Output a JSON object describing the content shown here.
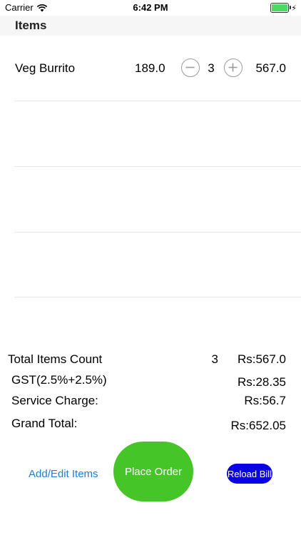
{
  "status_bar": {
    "carrier": "Carrier",
    "time": "6:42 PM",
    "wifi_icon": "wifi-icon",
    "battery_icon": "battery-icon",
    "charging_icon": "bolt-icon"
  },
  "section": {
    "title": "Items"
  },
  "items": [
    {
      "name": "Veg Burrito",
      "price": "189.0",
      "quantity": "3",
      "total": "567.0"
    }
  ],
  "summary": {
    "total_items_label": "Total Items Count",
    "total_items_count": "3",
    "subtotal": "Rs:567.0",
    "gst_label": "GST(2.5%+2.5%)",
    "gst_value": "Rs:28.35",
    "service_charge_label": "Service Charge:",
    "service_charge_value": "Rs:56.7",
    "grand_total_label": "Grand Total:",
    "grand_total_value": "Rs:652.05"
  },
  "actions": {
    "add_edit_label": "Add/Edit Items",
    "place_order_label": "Place Order",
    "reload_bill_label": "Reload Bill"
  },
  "colors": {
    "link": "#1d7ddc",
    "place_order_bg": "#45c527",
    "reload_bill_bg": "#0a00e8",
    "battery_fill": "#4cd964"
  }
}
